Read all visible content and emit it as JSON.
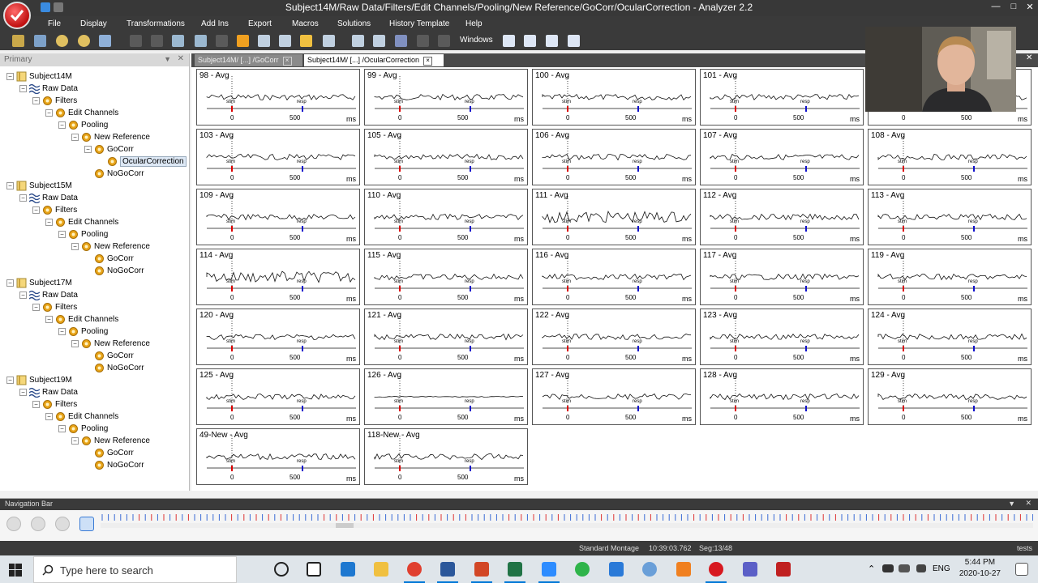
{
  "window": {
    "title": "Subject14M/Raw Data/Filters/Edit Channels/Pooling/New Reference/GoCorr/OcularCorrection - Analyzer 2.2",
    "brand_color": "#d71920"
  },
  "menu": [
    "File",
    "Display",
    "Transformations",
    "Add Ins",
    "Export",
    "Macros",
    "Solutions",
    "History Template",
    "Help"
  ],
  "toolbar": {
    "windows_label": "Windows"
  },
  "sidebar": {
    "title": "Primary",
    "tree": [
      {
        "label": "Subject14M",
        "level": 0,
        "icon": "book-icon"
      },
      {
        "label": "Raw Data",
        "level": 1,
        "icon": "waves-icon"
      },
      {
        "label": "Filters",
        "level": 2,
        "icon": "gear-icon"
      },
      {
        "label": "Edit Channels",
        "level": 3,
        "icon": "gear-icon"
      },
      {
        "label": "Pooling",
        "level": 4,
        "icon": "gear-icon"
      },
      {
        "label": "New Reference",
        "level": 5,
        "icon": "gear-icon"
      },
      {
        "label": "GoCorr",
        "level": 6,
        "icon": "gear-icon"
      },
      {
        "label": "OcularCorrection",
        "level": 7,
        "icon": "gear-icon",
        "selected": true
      },
      {
        "label": "NoGoCorr",
        "level": 6,
        "icon": "gear-icon"
      },
      {
        "label": "Subject15M",
        "level": 0,
        "icon": "book-icon"
      },
      {
        "label": "Raw Data",
        "level": 1,
        "icon": "waves-icon"
      },
      {
        "label": "Filters",
        "level": 2,
        "icon": "gear-icon"
      },
      {
        "label": "Edit Channels",
        "level": 3,
        "icon": "gear-icon"
      },
      {
        "label": "Pooling",
        "level": 4,
        "icon": "gear-icon"
      },
      {
        "label": "New Reference",
        "level": 5,
        "icon": "gear-icon"
      },
      {
        "label": "GoCorr",
        "level": 6,
        "icon": "gear-icon"
      },
      {
        "label": "NoGoCorr",
        "level": 6,
        "icon": "gear-icon"
      },
      {
        "label": "Subject17M",
        "level": 0,
        "icon": "book-icon"
      },
      {
        "label": "Raw Data",
        "level": 1,
        "icon": "waves-icon"
      },
      {
        "label": "Filters",
        "level": 2,
        "icon": "gear-icon"
      },
      {
        "label": "Edit Channels",
        "level": 3,
        "icon": "gear-icon"
      },
      {
        "label": "Pooling",
        "level": 4,
        "icon": "gear-icon"
      },
      {
        "label": "New Reference",
        "level": 5,
        "icon": "gear-icon"
      },
      {
        "label": "GoCorr",
        "level": 6,
        "icon": "gear-icon"
      },
      {
        "label": "NoGoCorr",
        "level": 6,
        "icon": "gear-icon"
      },
      {
        "label": "Subject19M",
        "level": 0,
        "icon": "book-icon"
      },
      {
        "label": "Raw Data",
        "level": 1,
        "icon": "waves-icon"
      },
      {
        "label": "Filters",
        "level": 2,
        "icon": "gear-icon"
      },
      {
        "label": "Edit Channels",
        "level": 3,
        "icon": "gear-icon"
      },
      {
        "label": "Pooling",
        "level": 4,
        "icon": "gear-icon"
      },
      {
        "label": "New Reference",
        "level": 5,
        "icon": "gear-icon"
      },
      {
        "label": "GoCorr",
        "level": 6,
        "icon": "gear-icon"
      },
      {
        "label": "NoGoCorr",
        "level": 6,
        "icon": "gear-icon"
      }
    ]
  },
  "tabs": [
    {
      "label": "Subject14M/ [...] /GoCorr",
      "active": false
    },
    {
      "label": "Subject14M/ [...] /OcularCorrection",
      "active": true
    }
  ],
  "panel_axis": {
    "tick_0": "0",
    "tick_500": "500",
    "unit": "ms",
    "marker_stim": "stim",
    "marker_resp": "resp"
  },
  "panels": [
    "98 - Avg",
    "99 - Avg",
    "100 - Avg",
    "101 - Avg",
    "",
    "103 - Avg",
    "105 - Avg",
    "106 - Avg",
    "107 - Avg",
    "108 - Avg",
    "109 - Avg",
    "110 - Avg",
    "111 - Avg",
    "112 - Avg",
    "113 - Avg",
    "114 - Avg",
    "115 - Avg",
    "116 - Avg",
    "117 - Avg",
    "119 - Avg",
    "120 - Avg",
    "121 - Avg",
    "122 - Avg",
    "123 - Avg",
    "124 - Avg",
    "125 - Avg",
    "126 - Avg",
    "127 - Avg",
    "128 - Avg",
    "129 - Avg",
    "49-New - Avg",
    "118-New - Avg"
  ],
  "navigation_bar": {
    "title": "Navigation Bar"
  },
  "status": {
    "montage": "Standard Montage",
    "time": "10:39:03.762",
    "segment": "Seg:13/48",
    "right": "tests"
  },
  "taskbar": {
    "search_placeholder": "Type here to search",
    "language": "ENG",
    "time": "5:44 PM",
    "date": "2020-10-27"
  }
}
